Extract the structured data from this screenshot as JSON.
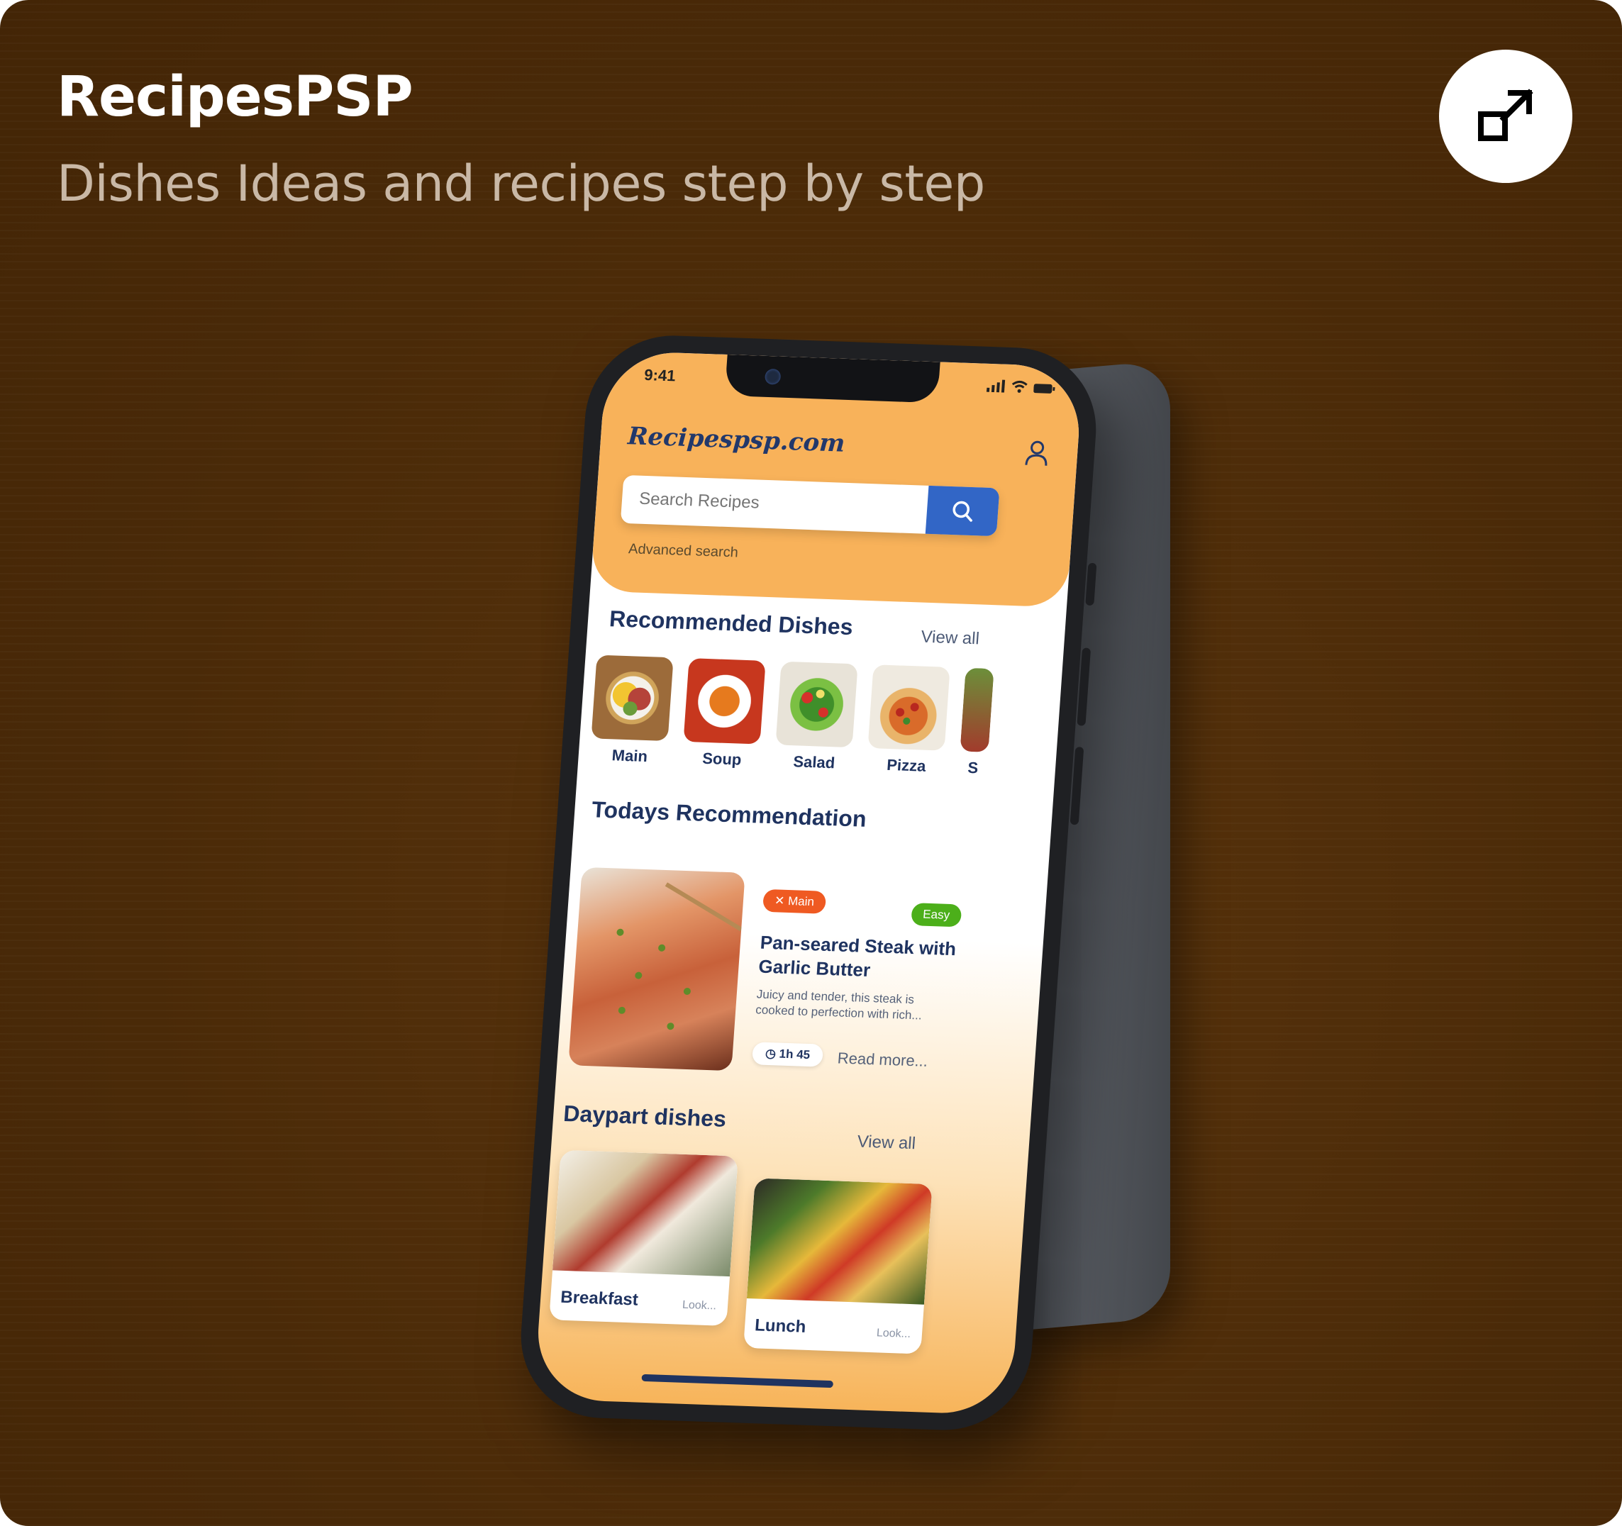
{
  "card": {
    "title": "RecipesPSP",
    "subtitle": "Dishes Ideas and recipes step by step",
    "open_icon": "external-link-icon"
  },
  "phone": {
    "status": {
      "time": "9:41"
    },
    "header": {
      "logo": "Recipespsp.com",
      "user_icon": "user-icon",
      "search_placeholder": "Search Recipes",
      "search_icon": "search-icon",
      "advanced_search": "Advanced search"
    },
    "recommended": {
      "title": "Recommended Dishes",
      "view_all": "View all",
      "categories": [
        {
          "label": "Main"
        },
        {
          "label": "Soup"
        },
        {
          "label": "Salad"
        },
        {
          "label": "Pizza"
        },
        {
          "label": "S"
        }
      ]
    },
    "today": {
      "title": "Todays Recommendation",
      "badge_category": "Main",
      "badge_difficulty": "Easy",
      "dish_title": "Pan-seared Steak with Garlic Butter",
      "dish_desc": "Juicy and tender, this steak is cooked to perfection with rich...",
      "duration": "1h 45",
      "read_more": "Read more..."
    },
    "daypart": {
      "title": "Daypart dishes",
      "view_all": "View all",
      "items": [
        {
          "label": "Breakfast",
          "look": "Look..."
        },
        {
          "label": "Lunch",
          "look": "Look..."
        }
      ]
    },
    "colors": {
      "accent": "#f8b25a",
      "brand_blue": "#3266c6",
      "navy": "#1f3360",
      "easy_green": "#4caf1a",
      "main_orange": "#ef5a22"
    }
  }
}
